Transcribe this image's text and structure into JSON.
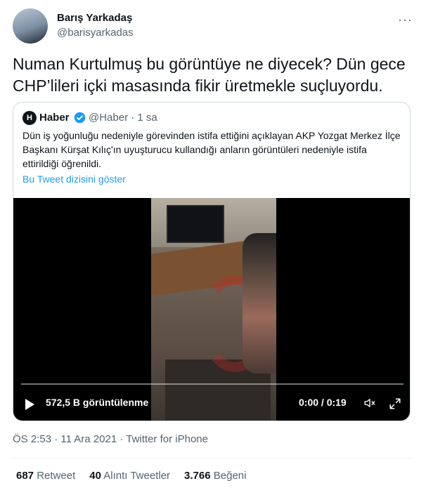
{
  "author": {
    "name": "Barış Yarkadaş",
    "handle": "@barisyarkadas"
  },
  "more_label": "···",
  "tweet_text": "Numan Kurtulmuş bu görüntüye ne diyecek? Dün gece CHP’lileri içki masasında fikir üretmekle suçluyordu.",
  "quote": {
    "logo_letter": "H",
    "name": "Haber",
    "handle": "@Haber · 1 sa",
    "text": "Dün iş yoğunluğu nedeniyle görevinden istifa ettiğini açıklayan AKP Yozgat Merkez İlçe Başkanı Kürşat Kılıç'ın uyuşturucu kullandığı anların görüntüleri nedeniyle istifa ettirildiği öğrenildi.",
    "thread_link": "Bu Tweet dizisini göster",
    "video": {
      "views": "572,5 B görüntülenme",
      "time": "0:00 / 0:19",
      "progress": 0
    }
  },
  "meta": {
    "time": "ÖS 2:53",
    "date": "11 Ara 2021",
    "source": "Twitter for iPhone",
    "separator": " · "
  },
  "stats": {
    "retweets": {
      "count": "687",
      "label": "Retweet"
    },
    "quotes": {
      "count": "40",
      "label": "Alıntı Tweetler"
    },
    "likes": {
      "count": "3.766",
      "label": "Beğeni"
    }
  },
  "colors": {
    "accent": "#1d9bf0",
    "text": "#0f1419",
    "muted": "#536471",
    "border": "#cfd9de"
  }
}
